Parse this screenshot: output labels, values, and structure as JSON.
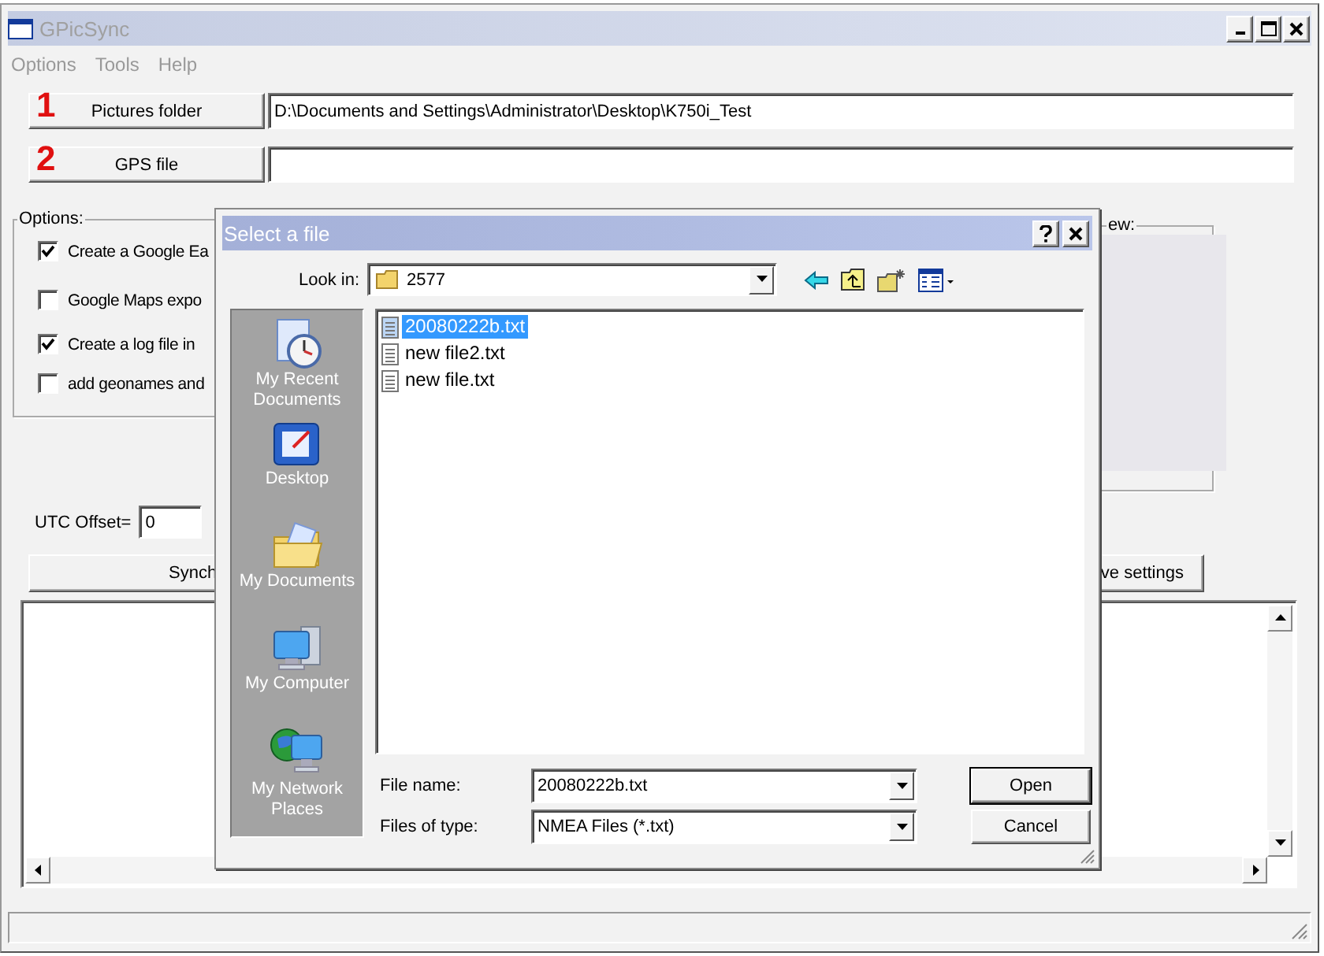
{
  "window": {
    "title": "GPicSync"
  },
  "menu": [
    "Options",
    "Tools",
    "Help"
  ],
  "pictures_folder": {
    "number": "1",
    "button": "Pictures folder",
    "value": "D:\\Documents and Settings\\Administrator\\Desktop\\K750i_Test"
  },
  "gps_file": {
    "number": "2",
    "button": "GPS file"
  },
  "options": {
    "title": "Options:",
    "items": [
      {
        "label": "Create a Google Ea",
        "checked": true
      },
      {
        "label": "Google Maps expo",
        "checked": false
      },
      {
        "label": "Create a log file in",
        "checked": true
      },
      {
        "label": "add geonames and",
        "checked": false
      }
    ]
  },
  "preview": {
    "title": "ew:"
  },
  "utc_offset": {
    "label": "UTC Offset=",
    "value": "0"
  },
  "buttons": [
    "Synch",
    "ve settings"
  ],
  "dialog": {
    "title": "Select a file",
    "look_in": {
      "label": "Look in:",
      "value": "2577"
    },
    "places": [
      {
        "kind": "recent",
        "label": "My Recent Documents"
      },
      {
        "kind": "desktop",
        "label": "Desktop"
      },
      {
        "kind": "documents",
        "label": "My Documents"
      },
      {
        "kind": "computer",
        "label": "My Computer"
      },
      {
        "kind": "network",
        "label": "My Network Places"
      }
    ],
    "files": [
      {
        "name": "20080222b.txt",
        "selected": true
      },
      {
        "name": "new file2.txt",
        "selected": false
      },
      {
        "name": "new file.txt",
        "selected": false
      }
    ],
    "file_name": {
      "label": "File name:",
      "value": "20080222b.txt"
    },
    "file_type": {
      "label": "Files of type:",
      "value": "NMEA Files (*.txt)"
    },
    "buttons": [
      "Open",
      "Cancel"
    ]
  }
}
